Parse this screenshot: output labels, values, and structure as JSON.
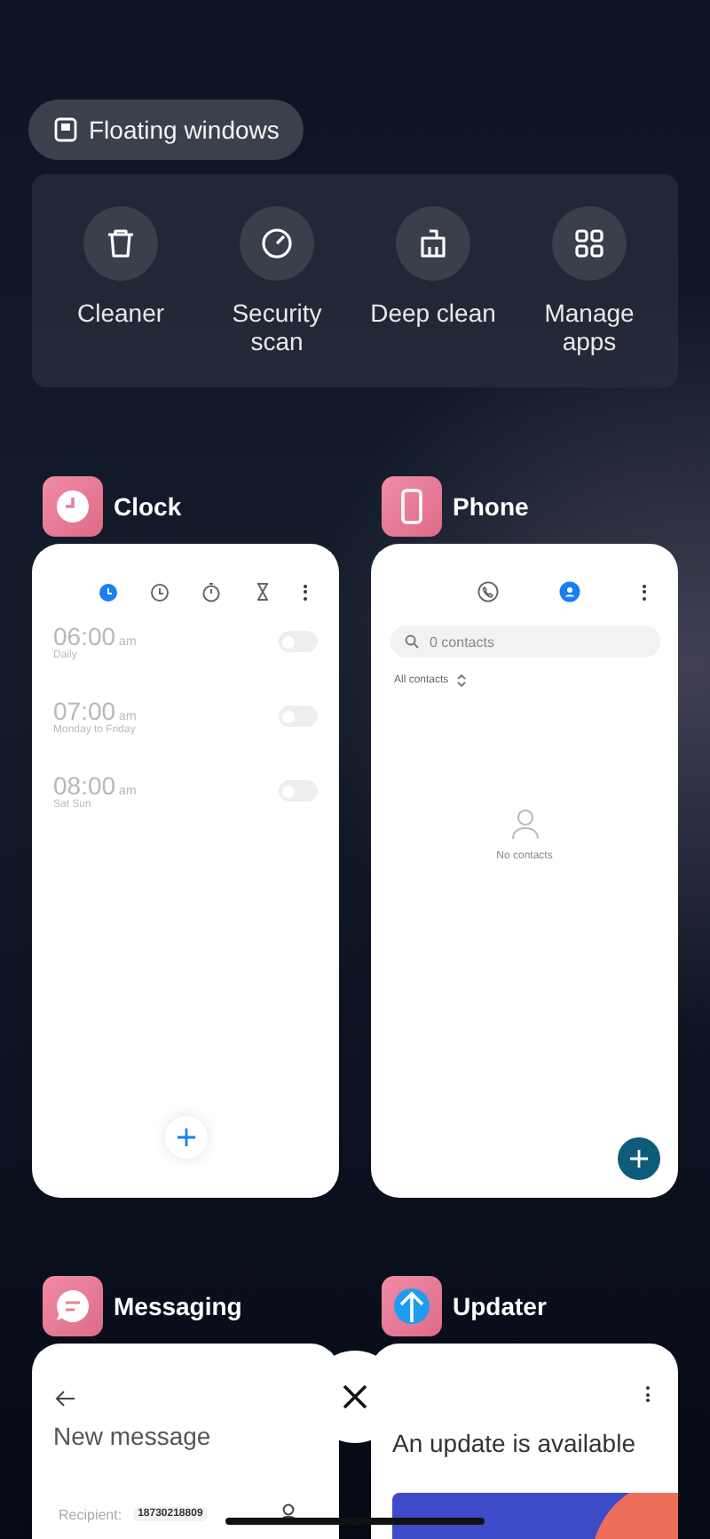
{
  "floating_windows": {
    "label": "Floating windows"
  },
  "quick_actions": [
    {
      "label": "Cleaner",
      "kind": "trash"
    },
    {
      "label": "Security scan",
      "kind": "gauge"
    },
    {
      "label": "Deep clean",
      "kind": "broom"
    },
    {
      "label": "Manage apps",
      "kind": "grid"
    }
  ],
  "apps": [
    {
      "name": "Clock",
      "kind": "clock",
      "tabs": [
        {
          "kind": "alarm",
          "selected": true
        },
        {
          "kind": "clock",
          "selected": false
        },
        {
          "kind": "stopwatch",
          "selected": false
        },
        {
          "kind": "timer",
          "selected": false
        }
      ],
      "alarms": [
        {
          "time": "06:00",
          "period": "am",
          "repeat": "Daily",
          "on": false
        },
        {
          "time": "07:00",
          "period": "am",
          "repeat": "Monday to Friday",
          "on": false
        },
        {
          "time": "08:00",
          "period": "am",
          "repeat": "Sat Sun",
          "on": false
        }
      ]
    },
    {
      "name": "Phone",
      "kind": "phone",
      "tabs": [
        {
          "kind": "call",
          "selected": false
        },
        {
          "kind": "contacts",
          "selected": true
        }
      ],
      "search": {
        "placeholder": "0 contacts"
      },
      "filter": "All contacts",
      "empty": "No contacts"
    },
    {
      "name": "Messaging",
      "kind": "messaging",
      "title": "New message",
      "recipient_label": "Recipient:",
      "recipient": "18730218809"
    },
    {
      "name": "Updater",
      "kind": "updater",
      "title": "An update is available"
    }
  ]
}
